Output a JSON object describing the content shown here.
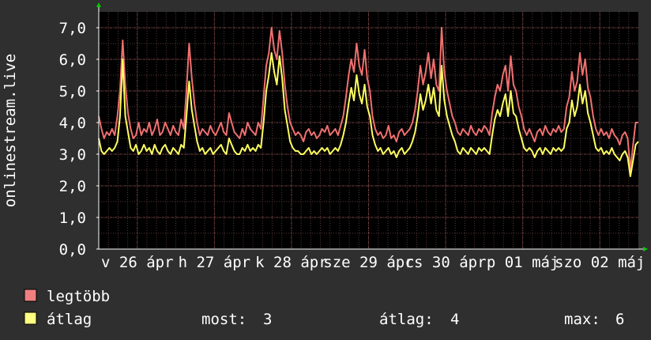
{
  "chart_data": {
    "type": "line",
    "ylabel": "onlinestream.live",
    "ylim": [
      0,
      7.5
    ],
    "yticks": [
      {
        "value": 0,
        "label": "0,0"
      },
      {
        "value": 1,
        "label": "1,0"
      },
      {
        "value": 2,
        "label": "2,0"
      },
      {
        "value": 3,
        "label": "3,0"
      },
      {
        "value": 4,
        "label": "4,0"
      },
      {
        "value": 5,
        "label": "5,0"
      },
      {
        "value": 6,
        "label": "6,0"
      },
      {
        "value": 7,
        "label": "7,0"
      }
    ],
    "xticks": [
      "v 26 ápr",
      "h 27 ápr",
      "k 28 ápr",
      "sze 29 ápr",
      "cs 30 ápr",
      "p 01 máj",
      "szo 02 máj"
    ],
    "grid": true,
    "legend_placement": "bottom",
    "colors": {
      "background": "#2f2f2f",
      "plot_background": "#000000",
      "grid_minor": "#5a3a3a",
      "grid_major": "#8a4a4a",
      "axis": "#ffffff",
      "arrow": "#00cc00"
    },
    "series": [
      {
        "name": "legtöbb",
        "color": "#f08080",
        "values": [
          4.2,
          3.8,
          3.5,
          3.7,
          3.6,
          3.8,
          3.6,
          4.2,
          5.0,
          6.6,
          5.2,
          4.3,
          3.8,
          3.5,
          3.6,
          4.0,
          3.6,
          3.8,
          3.7,
          4.0,
          3.6,
          3.8,
          4.1,
          3.6,
          3.7,
          4.0,
          3.8,
          3.6,
          3.9,
          3.7,
          3.6,
          4.1,
          3.8,
          5.0,
          6.5,
          5.4,
          4.6,
          4.0,
          3.6,
          3.8,
          3.7,
          3.6,
          3.9,
          3.7,
          3.6,
          3.8,
          4.0,
          3.7,
          3.6,
          4.3,
          4.0,
          3.7,
          3.6,
          3.5,
          3.8,
          3.6,
          4.0,
          3.8,
          3.7,
          3.6,
          4.0,
          3.8,
          4.8,
          5.8,
          6.2,
          7.0,
          6.3,
          6.0,
          6.9,
          6.2,
          5.2,
          4.5,
          4.0,
          3.8,
          3.6,
          3.7,
          3.6,
          3.4,
          3.7,
          3.8,
          3.6,
          3.7,
          3.5,
          3.6,
          3.8,
          3.7,
          3.9,
          3.6,
          3.7,
          3.8,
          3.6,
          3.9,
          4.2,
          4.8,
          5.5,
          6.0,
          5.6,
          6.5,
          5.8,
          5.5,
          6.3,
          5.4,
          5.0,
          4.2,
          3.8,
          3.6,
          3.7,
          3.5,
          3.6,
          3.9,
          3.5,
          3.6,
          3.4,
          3.7,
          3.8,
          3.6,
          3.7,
          3.8,
          4.0,
          4.4,
          5.0,
          5.8,
          5.2,
          5.6,
          6.2,
          5.4,
          6.0,
          5.2,
          5.0,
          7.0,
          5.6,
          5.0,
          4.6,
          4.2,
          4.0,
          3.7,
          3.6,
          3.8,
          3.7,
          3.6,
          3.9,
          3.7,
          3.6,
          3.8,
          3.7,
          3.9,
          3.8,
          3.6,
          4.3,
          4.8,
          5.2,
          5.0,
          5.5,
          5.8,
          5.0,
          6.1,
          5.2,
          5.0,
          4.5,
          4.2,
          3.8,
          3.6,
          3.8,
          3.6,
          3.4,
          3.7,
          3.8,
          3.6,
          3.9,
          3.7,
          3.6,
          3.8,
          3.7,
          3.9,
          3.7,
          3.8,
          4.5,
          4.8,
          5.6,
          5.0,
          5.3,
          6.2,
          5.5,
          6.0,
          5.1,
          4.8,
          4.2,
          3.8,
          3.6,
          3.8,
          3.6,
          3.7,
          3.5,
          3.8,
          3.6,
          3.5,
          3.3,
          3.6,
          3.7,
          3.5,
          2.5,
          3.3,
          4.0,
          4.0
        ],
        "line_color": "#f07070"
      },
      {
        "name": "átlag",
        "color": "#ffff80",
        "values": [
          3.5,
          3.1,
          3.0,
          3.1,
          3.2,
          3.1,
          3.2,
          3.4,
          4.2,
          6.0,
          4.2,
          3.7,
          3.2,
          3.1,
          3.3,
          3.0,
          3.1,
          3.3,
          3.1,
          3.2,
          3.0,
          3.3,
          3.1,
          3.0,
          3.2,
          3.3,
          3.1,
          3.0,
          3.2,
          3.1,
          3.0,
          3.3,
          3.2,
          4.2,
          5.3,
          4.4,
          3.9,
          3.4,
          3.1,
          3.2,
          3.0,
          3.1,
          3.2,
          3.0,
          3.1,
          3.2,
          3.3,
          3.1,
          3.0,
          3.5,
          3.3,
          3.1,
          3.0,
          3.0,
          3.2,
          3.1,
          3.3,
          3.1,
          3.2,
          3.1,
          3.3,
          3.2,
          4.0,
          5.0,
          5.5,
          6.2,
          5.6,
          5.2,
          6.1,
          5.4,
          4.4,
          3.9,
          3.4,
          3.2,
          3.1,
          3.1,
          3.0,
          3.0,
          3.1,
          3.2,
          3.0,
          3.1,
          3.0,
          3.1,
          3.2,
          3.1,
          3.2,
          3.0,
          3.1,
          3.2,
          3.1,
          3.3,
          3.6,
          4.0,
          4.6,
          5.1,
          4.7,
          5.5,
          4.9,
          4.6,
          5.2,
          4.5,
          4.2,
          3.6,
          3.3,
          3.1,
          3.2,
          3.0,
          3.1,
          3.2,
          3.0,
          3.1,
          2.9,
          3.1,
          3.2,
          3.0,
          3.1,
          3.2,
          3.4,
          3.7,
          4.2,
          4.9,
          4.4,
          4.7,
          5.2,
          4.6,
          5.1,
          4.4,
          4.2,
          5.8,
          4.7,
          4.2,
          3.9,
          3.6,
          3.4,
          3.1,
          3.0,
          3.2,
          3.1,
          3.0,
          3.2,
          3.1,
          3.0,
          3.2,
          3.1,
          3.2,
          3.1,
          3.0,
          3.6,
          4.1,
          4.4,
          4.2,
          4.6,
          4.9,
          4.2,
          5.0,
          4.3,
          4.2,
          3.8,
          3.5,
          3.2,
          3.1,
          3.2,
          3.1,
          2.9,
          3.1,
          3.2,
          3.0,
          3.2,
          3.1,
          3.0,
          3.2,
          3.1,
          3.2,
          3.1,
          3.2,
          3.8,
          4.0,
          4.7,
          4.2,
          4.5,
          5.2,
          4.6,
          5.0,
          4.3,
          4.0,
          3.6,
          3.2,
          3.1,
          3.2,
          3.0,
          3.1,
          3.0,
          3.2,
          3.0,
          2.9,
          2.8,
          3.0,
          3.1,
          2.9,
          2.3,
          2.8,
          3.3,
          3.4
        ],
        "line_color": "#ffff60"
      }
    ],
    "stats": {
      "now_label": "most:",
      "now_value": "3",
      "avg_label": "átlag:",
      "avg_value": "4",
      "max_label": "max:",
      "max_value": "6"
    }
  }
}
